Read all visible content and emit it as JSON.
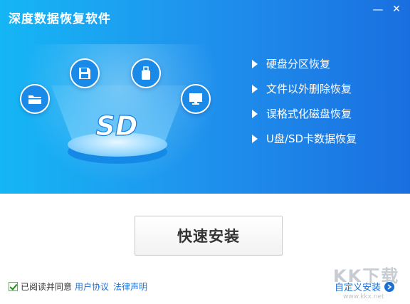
{
  "window": {
    "title": "深度数据恢复软件",
    "minimize_glyph": "—",
    "close_glyph": "✕"
  },
  "illustration": {
    "logo_text": "SD",
    "icons": [
      "folder-icon",
      "floppy-disk-icon",
      "usb-drive-icon",
      "monitor-icon"
    ]
  },
  "features": [
    {
      "label": "硬盘分区恢复"
    },
    {
      "label": "文件以外删除恢复"
    },
    {
      "label": "误格式化磁盘恢复"
    },
    {
      "label": "U盘/SD卡数据恢复"
    }
  ],
  "actions": {
    "install_label": "快速安装",
    "custom_install_label": "自定义安装"
  },
  "agreement": {
    "checked": true,
    "text": "已阅读并同意",
    "user_agreement_link": "用户协议",
    "legal_notice_link": "法律声明"
  },
  "watermark": {
    "logo": "KK下载",
    "url": "www.kkx.net"
  },
  "colors": {
    "banner_start": "#15b6f5",
    "banner_end": "#1a6fe0",
    "link": "#1a73d8"
  }
}
